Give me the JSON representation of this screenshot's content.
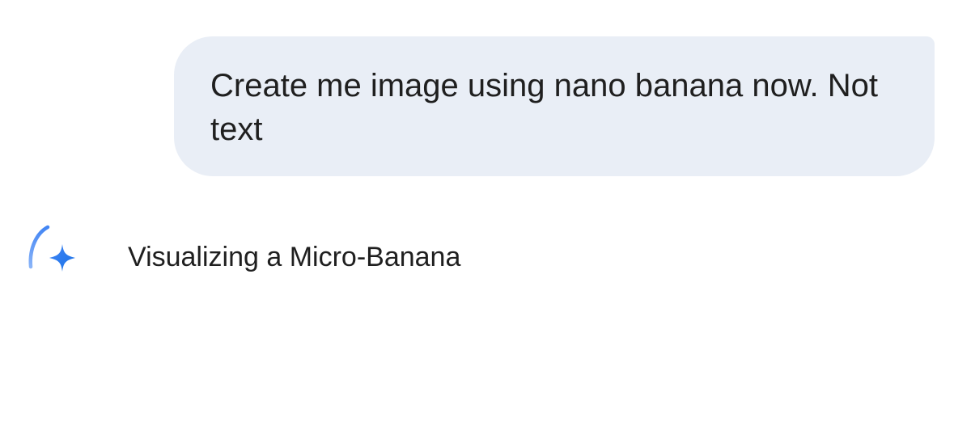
{
  "conversation": {
    "user_message": "Create me image using nano banana now. Not text",
    "assistant_status": {
      "text": "Visualizing a Micro-Banana",
      "icon": "gemini-spark-loading-icon"
    }
  },
  "colors": {
    "bubble_background": "#e9eef6",
    "text": "#1f1f1f",
    "spark_blue": "#4285f4",
    "spinner_blue": "#8ab4f8"
  }
}
